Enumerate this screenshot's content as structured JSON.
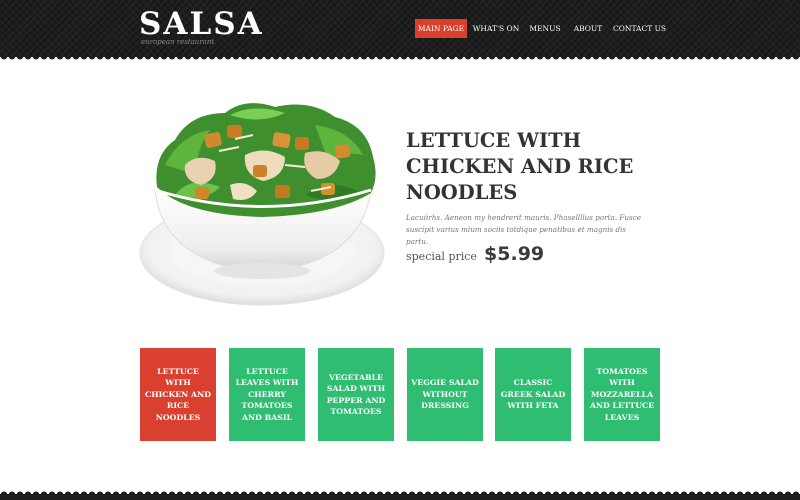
{
  "header": {
    "logo": "SALSA",
    "tagline": "european restaurant",
    "nav": [
      {
        "label": "MAIN PAGE",
        "active": true
      },
      {
        "label": "WHAT'S ON",
        "active": false
      },
      {
        "label": "MENUS",
        "active": false
      },
      {
        "label": "ABOUT",
        "active": false
      },
      {
        "label": "CONTACT US",
        "active": false
      }
    ]
  },
  "hero": {
    "image": "salad-bowl",
    "title": "LETTUCE WITH CHICKEN AND RICE NOODLES",
    "description": "Lacuiirhs. Aeneon my  hendrerit mauris. Phasellllus porta. Fusce suscipit varius mium sociis totdique penatibus et magnis dis partu.",
    "price_label": "special price",
    "price": "$5.99"
  },
  "tiles": [
    {
      "label": "LETTUCE WITH CHICKEN AND RICE NOODLES",
      "color": "#d9402f",
      "active": true
    },
    {
      "label": "LETTUCE LEAVES WITH CHERRY TOMATOES AND BASIL",
      "color": "#2fbd72",
      "active": false
    },
    {
      "label": "VEGETABLE SALAD WITH PEPPER AND TOMATOES",
      "color": "#2fbd72",
      "active": false
    },
    {
      "label": "VEGGIE SALAD WITHOUT DRESSING",
      "color": "#2fbd72",
      "active": false
    },
    {
      "label": "CLASSIC GREEK SALAD WITH FETA",
      "color": "#2fbd72",
      "active": false
    },
    {
      "label": "TOMATOES WITH MOZZARELLA AND LETTUCE LEAVES",
      "color": "#2fbd72",
      "active": false
    }
  ],
  "colors": {
    "header_bg": "#1e1e1e",
    "accent_red": "#d9402f",
    "accent_green": "#2fbd72",
    "title_text": "#333333"
  }
}
